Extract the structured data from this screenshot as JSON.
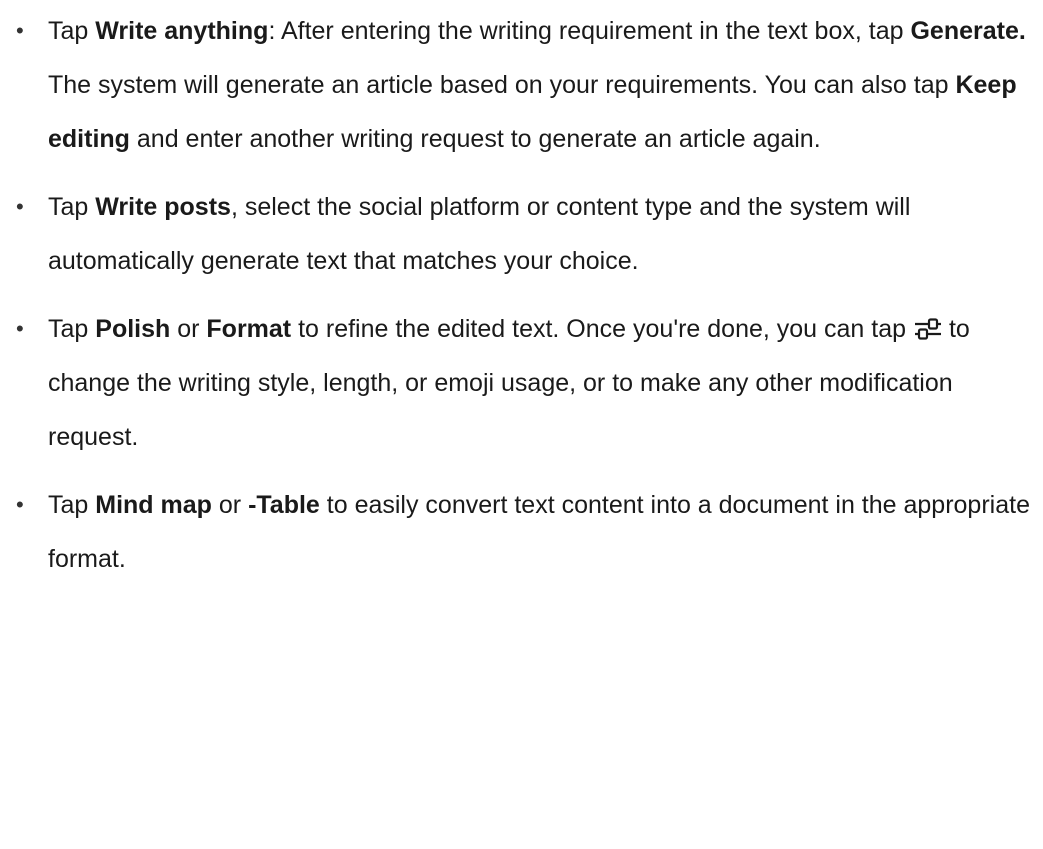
{
  "bullet_char": "•",
  "items": [
    {
      "t1": "Tap ",
      "b1": "Write anything",
      "t2": ": After entering the writing requirement in the text box, tap ",
      "b2": "Generate.",
      "t3": " The system will generate an article based on your requirements. You can also tap ",
      "b3": "Keep editing",
      "t4": " and enter another writing request to generate an article again."
    },
    {
      "t1": "Tap ",
      "b1": "Write posts",
      "t2": ", select the social platform or content type and the system will automatically generate text that matches your choice."
    },
    {
      "t1": "Tap ",
      "b1": "Polish",
      "t2": " or ",
      "b2": "Format",
      "t3": " to refine the edited text. Once you're done, you can tap ",
      "icon": "adjust-settings-icon",
      "t4": "to change the writing style, length, or emoji usage, or to make any other modification request."
    },
    {
      "t1": "Tap ",
      "b1": "Mind map",
      "t2": " or ",
      "b2": "-Table",
      "t3": " to easily convert text content into a document in the appropriate format."
    }
  ]
}
